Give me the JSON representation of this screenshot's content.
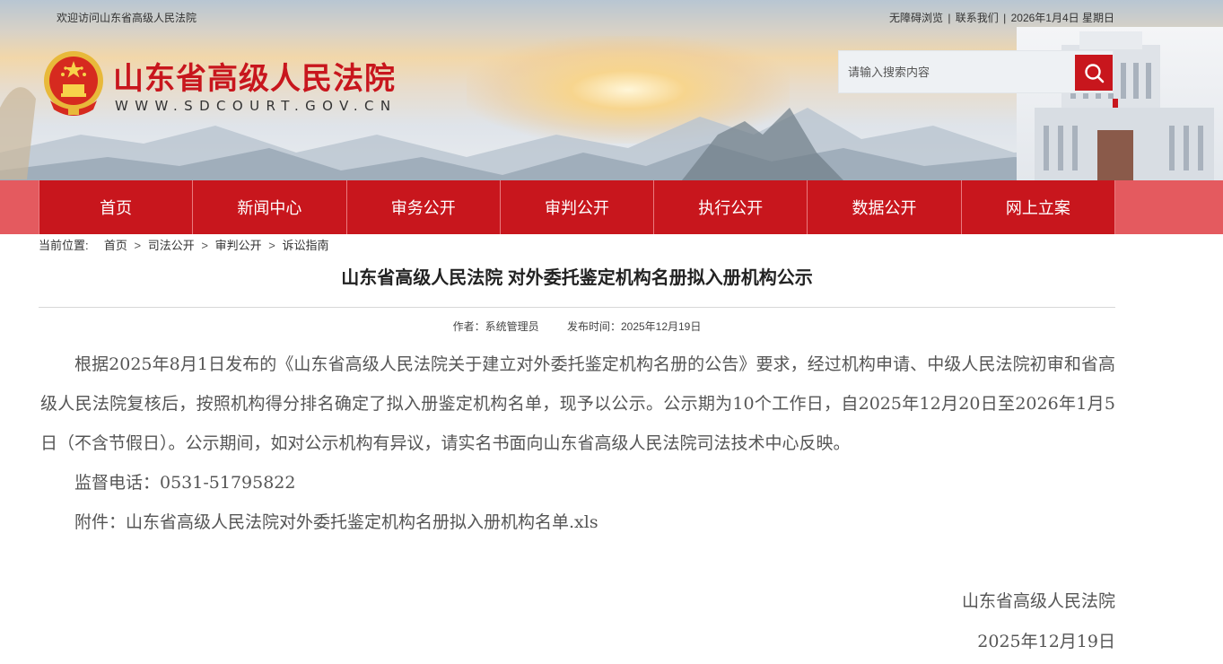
{
  "header": {
    "welcome": "欢迎访问山东省高级人民法院",
    "links": [
      "无障碍浏览",
      "联系我们"
    ],
    "separator": "|",
    "date": "2026年1月4日 星期日",
    "logo_cn": "山东省高级人民法院",
    "logo_en": "WWW.SDCOURT.GOV.CN",
    "search_placeholder": "请输入搜索内容",
    "search_icon": "search-icon",
    "emblem_icon": "national-emblem"
  },
  "nav": {
    "items": [
      "首页",
      "新闻中心",
      "审务公开",
      "审判公开",
      "执行公开",
      "数据公开",
      "网上立案"
    ]
  },
  "breadcrumb": {
    "label": "当前位置:",
    "items": [
      "首页",
      "司法公开",
      "审判公开",
      "诉讼指南"
    ],
    "sep": ">"
  },
  "article": {
    "title": "山东省高级人民法院 对外委托鉴定机构名册拟入册机构公示",
    "author": "作者：系统管理员",
    "published": "发布时间：2025年12月19日",
    "paragraph1": "根据2025年8月1日发布的《山东省高级人民法院关于建立对外委托鉴定机构名册的公告》要求，经过机构申请、中级人民法院初审和省高级人民法院复核后，按照机构得分排名确定了拟入册鉴定机构名单，现予以公示。公示期为10个工作日，自2025年12月20日至2026年1月5日（不含节假日）。公示期间，如对公示机构有异议，请实名书面向山东省高级人民法院司法技术中心反映。",
    "phone": "监督电话：0531-51795822",
    "attachment_label": "附件：",
    "attachment_link": "山东省高级人民法院对外委托鉴定机构名册拟入册机构名单.xls",
    "signature": "山东省高级人民法院",
    "sign_date": "2025年12月19日"
  },
  "colors": {
    "brand_red": "#c8161d",
    "nav_side": "#e45a5f"
  }
}
